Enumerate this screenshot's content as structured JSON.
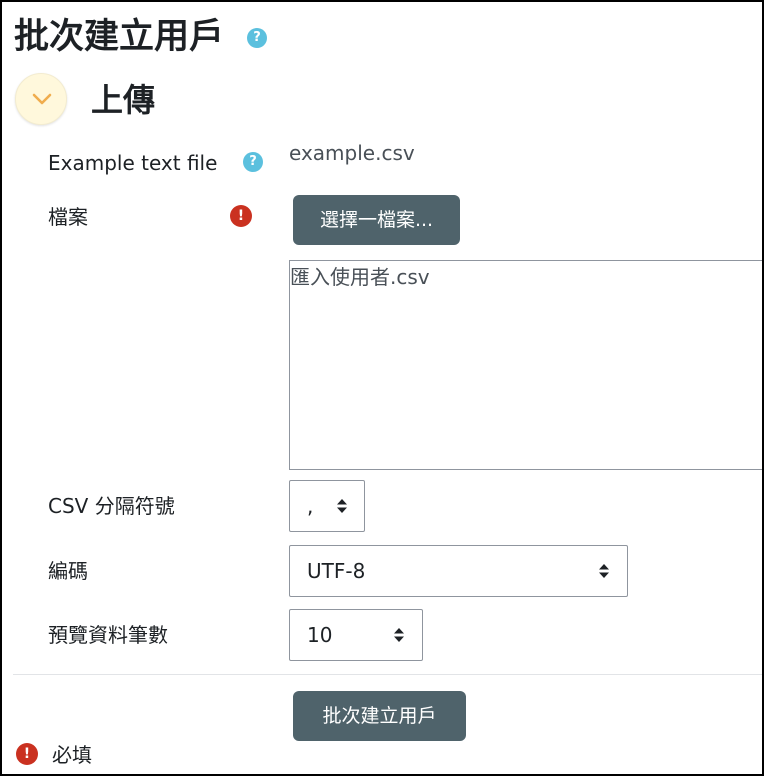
{
  "page": {
    "title": "批次建立用戶",
    "help_icon_glyph": "?"
  },
  "section": {
    "title": "上傳",
    "toggle_icon": "chevron-down-icon"
  },
  "form": {
    "example": {
      "label": "Example text file",
      "help_icon_glyph": "?",
      "value": "example.csv"
    },
    "file": {
      "label": "檔案",
      "required_icon_glyph": "!",
      "choose_button": "選擇一檔案...",
      "selected_file": "匯入使用者.csv"
    },
    "delimiter": {
      "label": "CSV 分隔符號",
      "selected": ","
    },
    "encoding": {
      "label": "編碼",
      "selected": "UTF-8"
    },
    "preview_rows": {
      "label": "預覽資料筆數",
      "selected": "10"
    },
    "submit_button": "批次建立用戶"
  },
  "footer": {
    "required_icon_glyph": "!",
    "required_text": "必填"
  },
  "colors": {
    "button": "#4f636b",
    "help_icon": "#5bc0de",
    "error_icon": "#ca3120",
    "toggle_bg": "#fff8dc",
    "chevron": "#f0ad4e"
  }
}
